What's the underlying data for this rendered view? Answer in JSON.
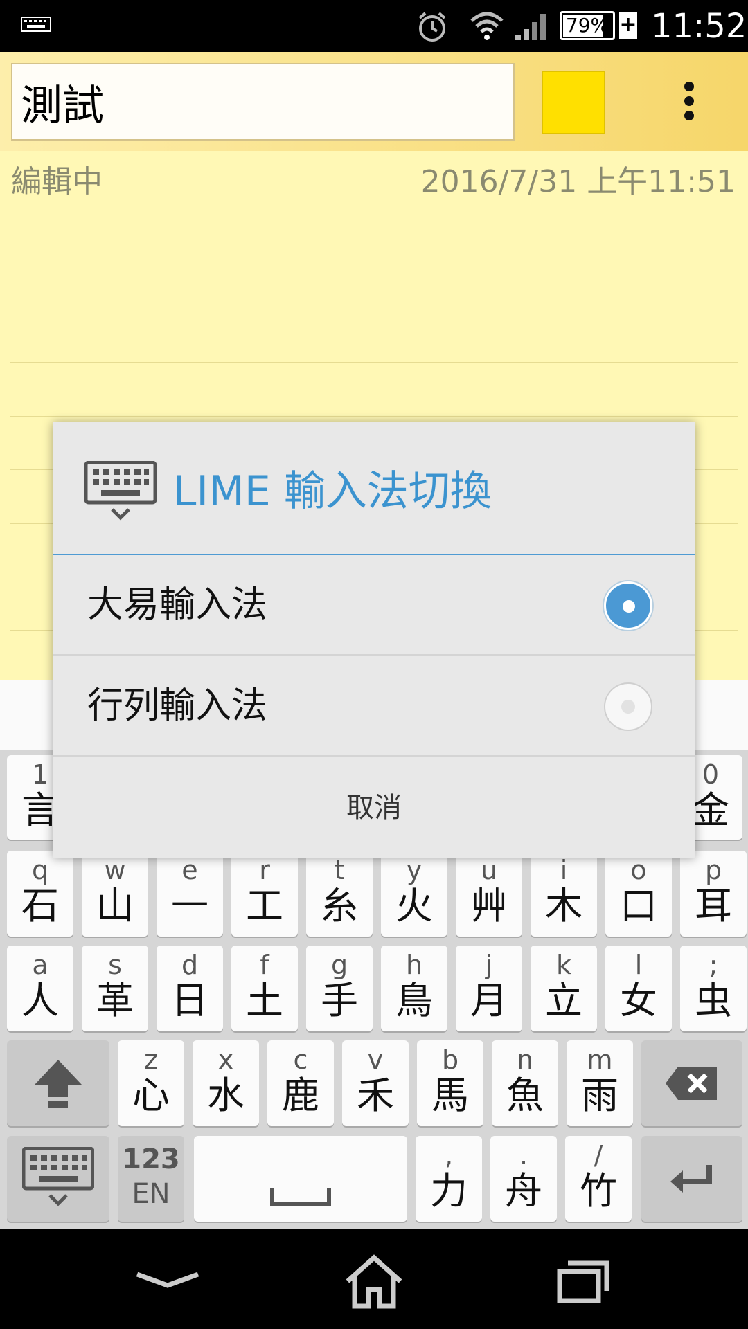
{
  "status_bar": {
    "battery": "79%",
    "battery_level": 0.79,
    "time": "11:52",
    "icons": [
      "keyboard-icon",
      "alarm-icon",
      "wifi-icon",
      "signal-icon",
      "battery-icon",
      "charging-plus-icon"
    ]
  },
  "app_bar": {
    "title_value": "測試",
    "color_swatch": "#ffe000",
    "menu_icon": "overflow-menu-icon"
  },
  "note": {
    "status": "編輯中",
    "timestamp": "2016/7/31 上午11:51"
  },
  "keyboard": {
    "row1": [
      {
        "en": "1",
        "zh": "言"
      },
      {
        "en": "0",
        "zh": "金"
      }
    ],
    "row2": [
      {
        "en": "q",
        "zh": "石"
      },
      {
        "en": "w",
        "zh": "山"
      },
      {
        "en": "e",
        "zh": "一"
      },
      {
        "en": "r",
        "zh": "工"
      },
      {
        "en": "t",
        "zh": "糸"
      },
      {
        "en": "y",
        "zh": "火"
      },
      {
        "en": "u",
        "zh": "艸"
      },
      {
        "en": "i",
        "zh": "木"
      },
      {
        "en": "o",
        "zh": "口"
      },
      {
        "en": "p",
        "zh": "耳"
      }
    ],
    "row3": [
      {
        "en": "a",
        "zh": "人"
      },
      {
        "en": "s",
        "zh": "革"
      },
      {
        "en": "d",
        "zh": "日"
      },
      {
        "en": "f",
        "zh": "土"
      },
      {
        "en": "g",
        "zh": "手"
      },
      {
        "en": "h",
        "zh": "鳥"
      },
      {
        "en": "j",
        "zh": "月"
      },
      {
        "en": "k",
        "zh": "立"
      },
      {
        "en": "l",
        "zh": "女"
      },
      {
        "en": ";",
        "zh": "虫"
      }
    ],
    "row4": [
      {
        "en": "z",
        "zh": "心"
      },
      {
        "en": "x",
        "zh": "水"
      },
      {
        "en": "c",
        "zh": "鹿"
      },
      {
        "en": "v",
        "zh": "禾"
      },
      {
        "en": "b",
        "zh": "馬"
      },
      {
        "en": "n",
        "zh": "魚"
      },
      {
        "en": "m",
        "zh": "雨"
      }
    ],
    "row5": {
      "mode_top": "123",
      "mode_bottom": "EN",
      "keys": [
        {
          "en": ",",
          "zh": "力"
        },
        {
          "en": ".",
          "zh": "舟"
        },
        {
          "en": "/",
          "zh": "竹"
        }
      ]
    }
  },
  "dialog": {
    "title": "LIME 輸入法切換",
    "options": [
      {
        "label": "大易輸入法",
        "selected": true
      },
      {
        "label": "行列輸入法",
        "selected": false
      }
    ],
    "cancel": "取消"
  },
  "nav_bar": {
    "buttons": [
      "back-icon",
      "home-icon",
      "recents-icon"
    ]
  }
}
